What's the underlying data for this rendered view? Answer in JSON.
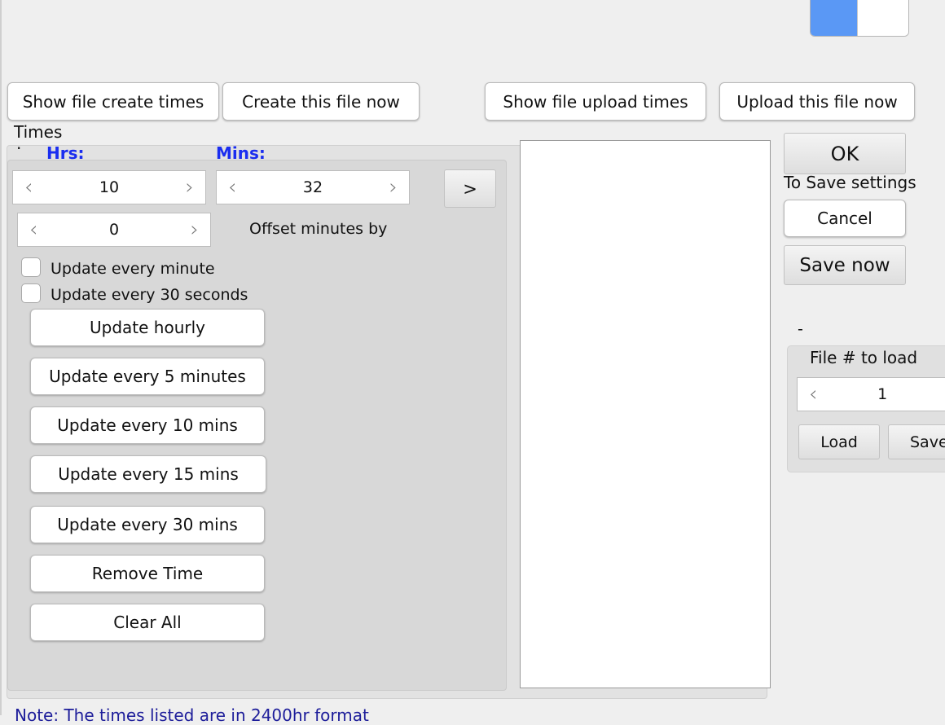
{
  "toolbar": {
    "show_create": "Show file create times",
    "create_now": "Create this file now",
    "show_upload": "Show file upload times",
    "upload_now": "Upload this file now"
  },
  "times": {
    "title": "Times",
    "dot": "·",
    "hrs_label": "Hrs:",
    "mins_label": "Mins:",
    "hrs_value": "10",
    "mins_value": "32",
    "add_label": ">",
    "offset_value": "0",
    "offset_label": "Offset minutes by",
    "chk_minute": "Update every minute",
    "chk_30s": "Update every 30 seconds",
    "buttons": {
      "hourly": "Update hourly",
      "every5": "Update every 5 minutes",
      "every10": "Update every 10 mins",
      "every15": "Update every 15 mins",
      "every30": "Update every 30 mins",
      "remove": "Remove Time",
      "clear": "Clear All"
    }
  },
  "right": {
    "ok": "OK",
    "save_hint": "To Save settings",
    "cancel": "Cancel",
    "save_now": "Save now",
    "dash": "-",
    "file_load_label": "File # to load",
    "file_value": "1",
    "load": "Load",
    "save": "Save"
  },
  "note": "Note: The times listed are in 2400hr format",
  "colors": {
    "accent_blue": "#5a98f5",
    "label_blue": "#1a2df0"
  }
}
